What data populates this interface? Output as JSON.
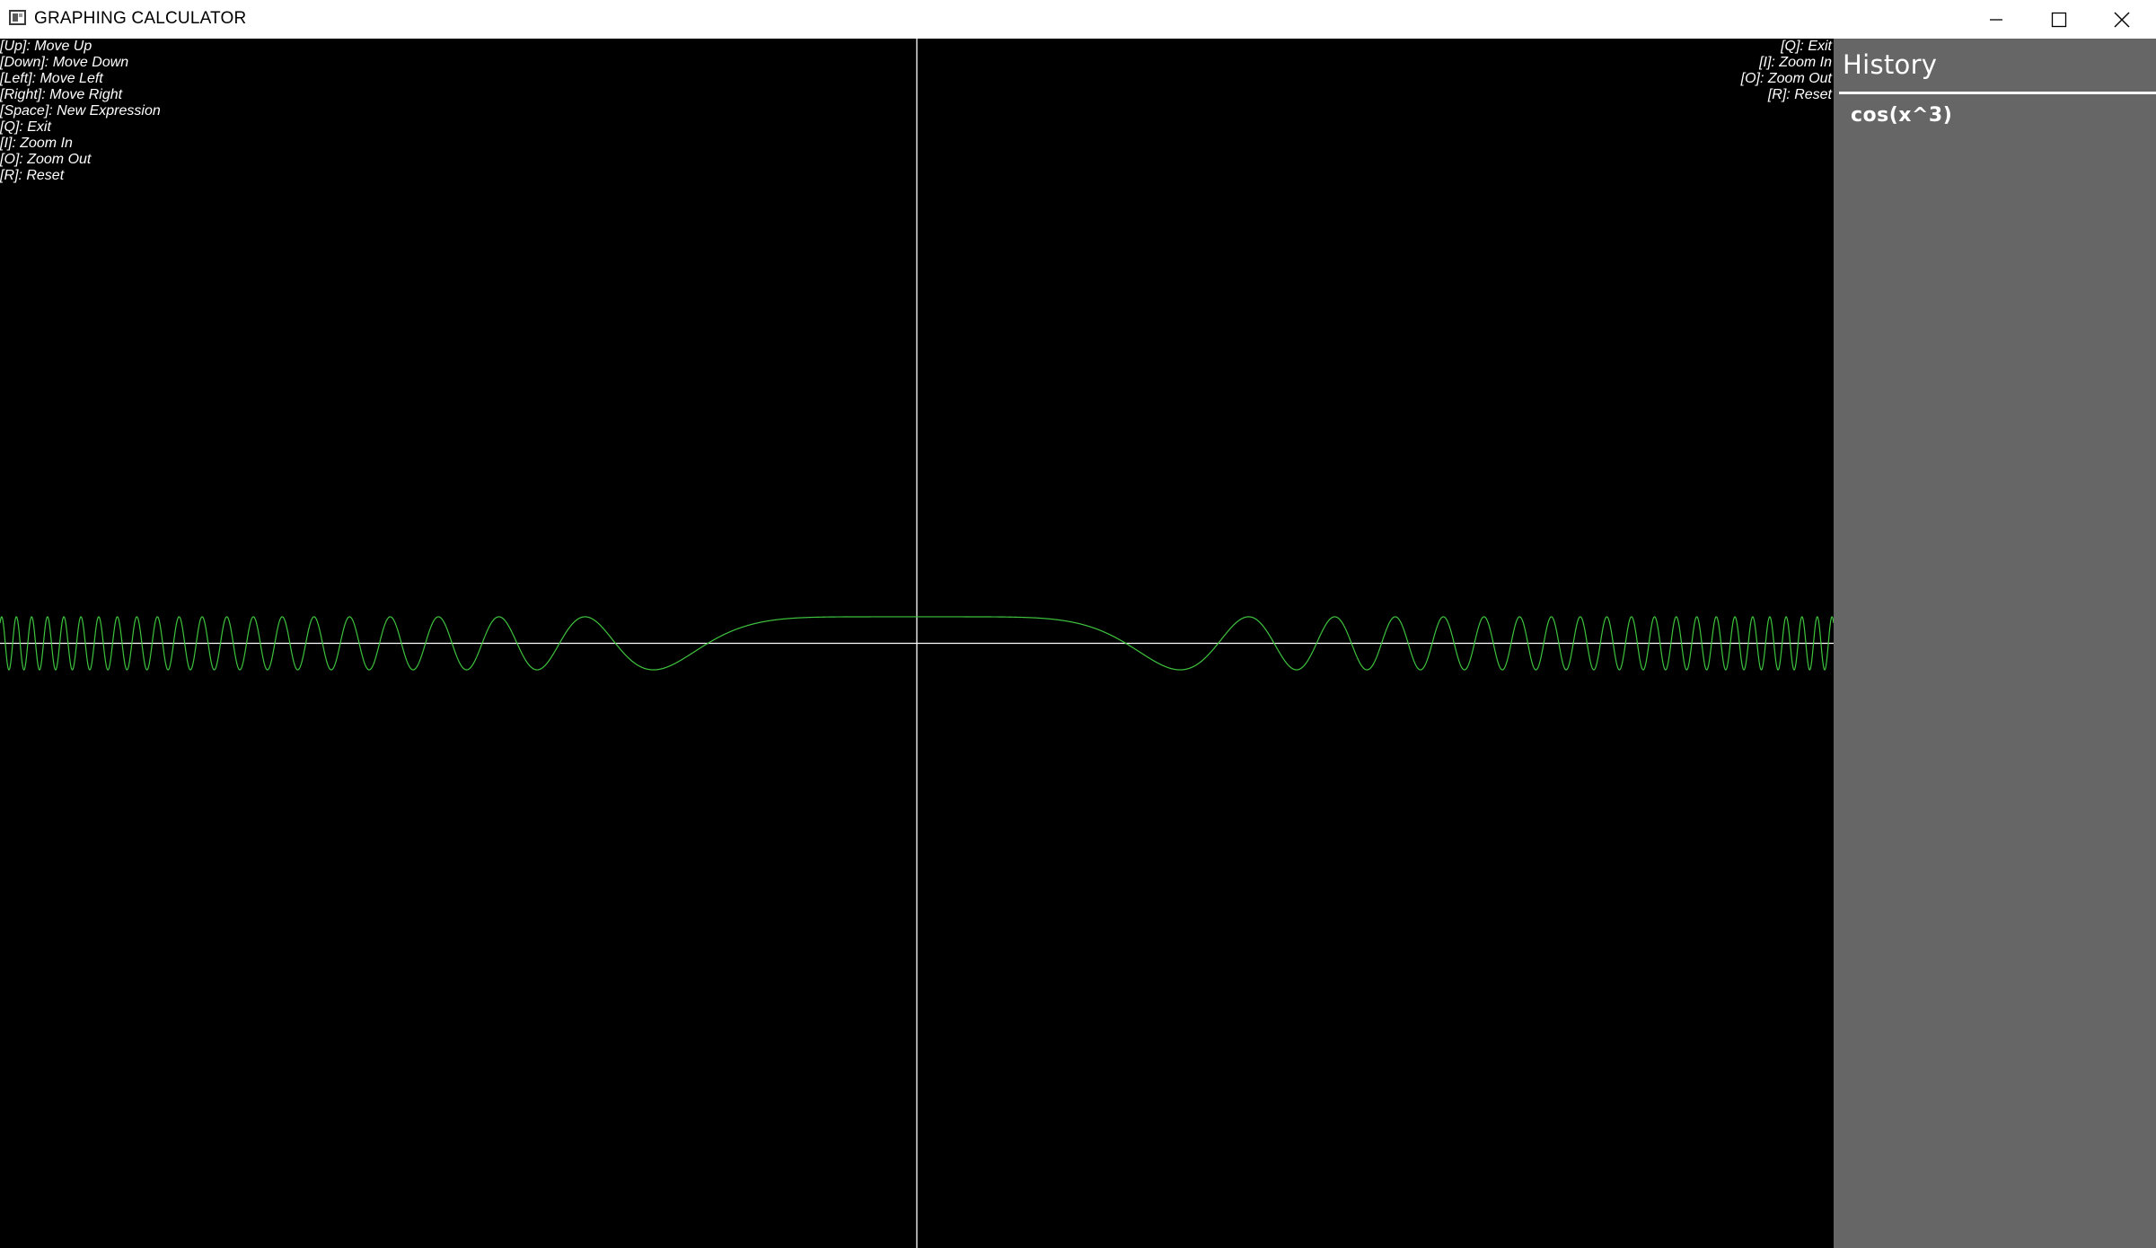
{
  "window": {
    "title": "GRAPHING CALCULATOR",
    "controls": [
      "minimize-icon",
      "maximize-icon",
      "close-icon"
    ]
  },
  "help_left": [
    "[Up]: Move Up",
    "[Down]: Move Down",
    "[Left]: Move Left",
    "[Right]: Move Right",
    "[Space]: New Expression",
    "[Q]: Exit",
    "[I]: Zoom In",
    "[O]: Zoom Out",
    "[R]: Reset"
  ],
  "help_right": [
    "[Q]: Exit",
    "[I]: Zoom In",
    "[O]: Zoom Out",
    "[R]: Reset"
  ],
  "history": {
    "title": "History",
    "items": [
      "cos(x^3)"
    ]
  },
  "colors": {
    "background": "#000000",
    "axes": "#ffffff",
    "curve": "#3ec43e",
    "history_panel": "#666666"
  },
  "chart_data": {
    "type": "line",
    "expression": "cos(x^3)",
    "xlim": [
      -5.1,
      5.1
    ],
    "ylim": [
      -22.8,
      22.8
    ],
    "grid": false
  }
}
